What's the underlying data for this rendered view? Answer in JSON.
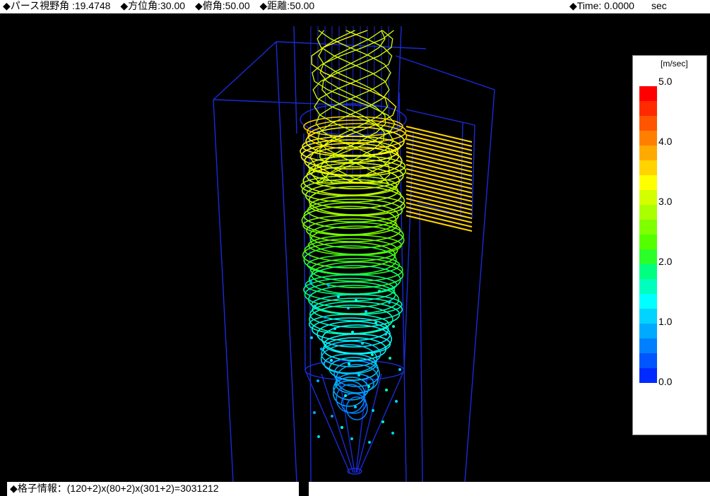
{
  "header": {
    "perspective": "◆パース視野角 :19.4748",
    "azimuth": "◆方位角:30.00",
    "elevation": "◆俯角:50.00",
    "distance": "◆距離:50.00",
    "time_label": "◆Time: 0.0000",
    "time_unit": "sec"
  },
  "legend": {
    "unit": "[m/sec]",
    "ticks": [
      "5.0",
      "4.0",
      "3.0",
      "2.0",
      "1.0",
      "0.0"
    ],
    "colors": [
      "#ff0000",
      "#ff2a00",
      "#ff5500",
      "#ff8000",
      "#ffaa00",
      "#ffd400",
      "#ffff00",
      "#d4ff00",
      "#aaff00",
      "#80ff00",
      "#55ff00",
      "#2aff2a",
      "#00ff80",
      "#00ffbf",
      "#00ffff",
      "#00d4ff",
      "#00aaff",
      "#0080ff",
      "#0055ff",
      "#002aff"
    ]
  },
  "footer": {
    "grid_info": "◆格子情報：(120+2)x(80+2)x(301+2)=3031212"
  },
  "colors": {
    "wireframe": "#1a2bd6",
    "inlet_streamlines": "#ffd400",
    "background": "#000000"
  }
}
